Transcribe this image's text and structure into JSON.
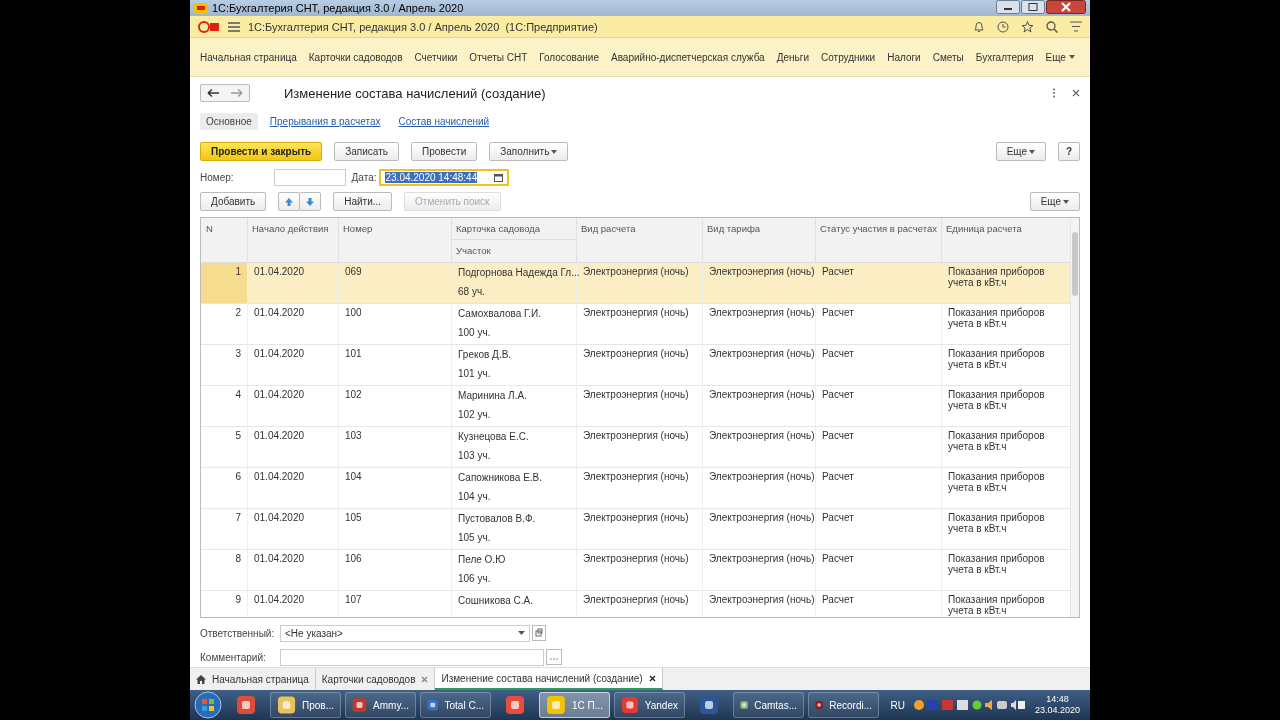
{
  "window": {
    "title": "1С:Бухгалтерия СНТ, редакция 3.0 / Апрель 2020"
  },
  "app": {
    "title": "1С:Бухгалтерия СНТ, редакция 3.0 / Апрель 2020  (1С:Предприятие)",
    "nav": [
      "Начальная страница",
      "Карточки садоводов",
      "Счетчики",
      "Отчеты СНТ",
      "Голосование",
      "Аварийно-диспетчерская служба",
      "Деньги",
      "Сотрудники",
      "Налоги",
      "Сметы",
      "Бухгалтерия"
    ],
    "nav_more": "Еще"
  },
  "form": {
    "title": "Изменение состава начислений (создание)",
    "tabs": [
      {
        "label": "Основное",
        "selected": true
      },
      {
        "label": "Прерывания в расчетах",
        "selected": false
      },
      {
        "label": "Состав начислений",
        "selected": false
      }
    ],
    "commands": [
      {
        "label": "Провести и закрыть",
        "kind": "primary"
      },
      {
        "label": "Записать",
        "kind": "plain"
      },
      {
        "label": "Провести",
        "kind": "plain"
      },
      {
        "label": "Заполнить",
        "kind": "dropdown"
      }
    ],
    "more": "Еще",
    "help": "?",
    "number_label": "Номер:",
    "date_label": "Дата:",
    "date_value": "23.04.2020 14:48:44",
    "date_focused": true,
    "table_commands": [
      {
        "label": "Добавить",
        "kind": "plain",
        "disabled": false
      },
      {
        "kind": "up",
        "disabled": false
      },
      {
        "kind": "down",
        "disabled": false
      },
      {
        "label": "Найти...",
        "kind": "plain",
        "disabled": false
      },
      {
        "label": "Отменить поиск",
        "kind": "plain",
        "disabled": true
      }
    ],
    "table_more": "Еще",
    "columns": [
      "N",
      "Начало действия",
      "Номер",
      "Карточка садовода",
      "Вид расчета",
      "Вид тарифа",
      "Статус участия в расчетах",
      "Единица расчета"
    ],
    "subcolumn": "Участок",
    "rows": [
      {
        "n": "1",
        "start": "01.04.2020",
        "number": "069",
        "member": "Подгорнова Надежда Гл...",
        "plot": "68 уч.",
        "calc": "Электроэнергия (ночь)",
        "tariff": "Электроэнергия (ночь)",
        "status": "Расчет",
        "unit": "Показания приборов учета в кВт.ч",
        "selected": true
      },
      {
        "n": "2",
        "start": "01.04.2020",
        "number": "100",
        "member": "Самохвалова Г.И.",
        "plot": "100 уч.",
        "calc": "Электроэнергия (ночь)",
        "tariff": "Электроэнергия (ночь)",
        "status": "Расчет",
        "unit": "Показания приборов учета в кВт.ч",
        "selected": false
      },
      {
        "n": "3",
        "start": "01.04.2020",
        "number": "101",
        "member": "Греков Д.В.",
        "plot": "101 уч.",
        "calc": "Электроэнергия (ночь)",
        "tariff": "Электроэнергия (ночь)",
        "status": "Расчет",
        "unit": "Показания приборов учета в кВт.ч",
        "selected": false
      },
      {
        "n": "4",
        "start": "01.04.2020",
        "number": "102",
        "member": "Маринина Л.А.",
        "plot": "102 уч.",
        "calc": "Электроэнергия (ночь)",
        "tariff": "Электроэнергия (ночь)",
        "status": "Расчет",
        "unit": "Показания приборов учета в кВт.ч",
        "selected": false
      },
      {
        "n": "5",
        "start": "01.04.2020",
        "number": "103",
        "member": "Кузнецова Е.С.",
        "plot": "103 уч.",
        "calc": "Электроэнергия (ночь)",
        "tariff": "Электроэнергия (ночь)",
        "status": "Расчет",
        "unit": "Показания приборов учета в кВт.ч",
        "selected": false
      },
      {
        "n": "6",
        "start": "01.04.2020",
        "number": "104",
        "member": "Сапожникова Е.В.",
        "plot": "104 уч.",
        "calc": "Электроэнергия (ночь)",
        "tariff": "Электроэнергия (ночь)",
        "status": "Расчет",
        "unit": "Показания приборов учета в кВт.ч",
        "selected": false
      },
      {
        "n": "7",
        "start": "01.04.2020",
        "number": "105",
        "member": "Пустовалов В.Ф.",
        "plot": "105 уч.",
        "calc": "Электроэнергия (ночь)",
        "tariff": "Электроэнергия (ночь)",
        "status": "Расчет",
        "unit": "Показания приборов учета в кВт.ч",
        "selected": false
      },
      {
        "n": "8",
        "start": "01.04.2020",
        "number": "106",
        "member": "Пеле О.Ю",
        "plot": "106 уч.",
        "calc": "Электроэнергия (ночь)",
        "tariff": "Электроэнергия (ночь)",
        "status": "Расчет",
        "unit": "Показания приборов учета в кВт.ч",
        "selected": false
      },
      {
        "n": "9",
        "start": "01.04.2020",
        "number": "107",
        "member": "Сошникова С.А.",
        "calc": "Электроэнергия (ночь)",
        "tariff": "Электроэнергия (ночь)",
        "status": "Расчет",
        "unit": "Показания приборов учета в кВт.ч",
        "selected": false
      }
    ],
    "responsible_label": "Ответственный:",
    "responsible_value": "<Не указан>",
    "comment_label": "Комментарий:"
  },
  "open_tabs": [
    {
      "label": "Начальная страница",
      "kind": "home",
      "selected": false
    },
    {
      "label": "Карточки садоводов",
      "kind": "closable",
      "selected": false
    },
    {
      "label": "Изменение состава начислений (создание)",
      "kind": "closable",
      "selected": true
    }
  ],
  "taskbar": {
    "items": [
      {
        "selected": false
      },
      {
        "label": "Пров...",
        "selected": false
      },
      {
        "label": "Ammy...",
        "selected": false
      },
      {
        "label": "Total C...",
        "selected": false
      },
      {
        "selected": false
      },
      {
        "label": "1С П...",
        "selected": true
      },
      {
        "label": "Yandex",
        "selected": false
      },
      {
        "selected": false
      },
      {
        "label": "Camtas...",
        "selected": false
      },
      {
        "label": "Recordi...",
        "selected": false
      }
    ],
    "lang": "RU",
    "time": "14:48",
    "date": "23.04.2020"
  }
}
